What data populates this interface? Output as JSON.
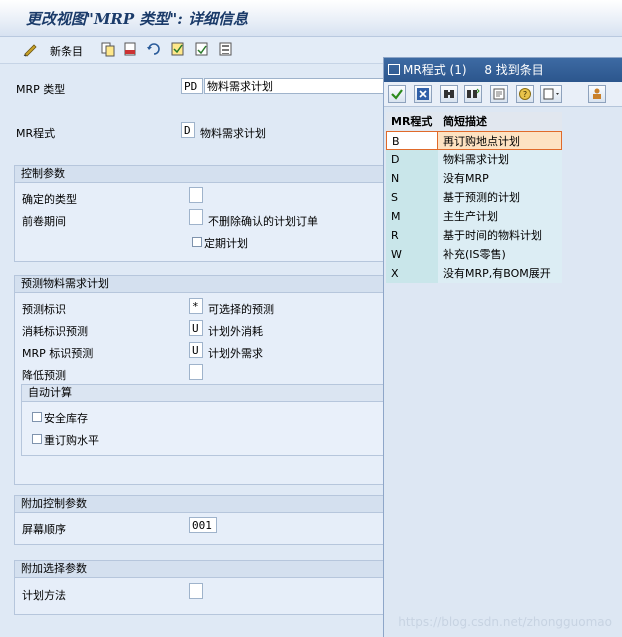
{
  "window_title": "更改视图\"MRP 类型\": 详细信息",
  "toolbar": {
    "new_entries": "新条目"
  },
  "fields": {
    "mrp_type_label": "MRP 类型",
    "mrp_type_code": "PD",
    "mrp_type_desc": "物料需求计划",
    "mrp_proc_label": "MR程式",
    "mrp_proc_code": "D",
    "mrp_proc_desc": "物料需求计划"
  },
  "control": {
    "header": "控制参数",
    "firm_type_label": "确定的类型",
    "rollfwd_label": "前卷期间",
    "rollfwd_text": "不删除确认的计划订单",
    "periodic_label": "定期计划"
  },
  "forecast": {
    "header": "预测物料需求计划",
    "ind_label": "预测标识",
    "ind_value": "*",
    "ind_text": "可选择的预测",
    "cons_label": "消耗标识预测",
    "cons_value": "U",
    "cons_text": "计划外消耗",
    "mrp_label": "MRP 标识预测",
    "mrp_value": "U",
    "mrp_text": "计划外需求",
    "reduce_label": "降低预测",
    "auto_header": "自动计算",
    "safety_label": "安全库存",
    "reorder_label": "重订购水平"
  },
  "additional": {
    "header": "附加控制参数",
    "screen_seq_label": "屏幕顺序",
    "screen_seq_value": "001"
  },
  "selection": {
    "header": "附加选择参数",
    "plan_method_label": "计划方法"
  },
  "popup": {
    "title": "MR程式 (1)",
    "count_text": "8 找到条目",
    "col_code": "MR程式",
    "col_desc": "简短描述",
    "rows": [
      {
        "code": "B",
        "desc": "再订购地点计划"
      },
      {
        "code": "D",
        "desc": "物料需求计划"
      },
      {
        "code": "N",
        "desc": "没有MRP"
      },
      {
        "code": "S",
        "desc": "基于预测的计划"
      },
      {
        "code": "M",
        "desc": "主生产计划"
      },
      {
        "code": "R",
        "desc": "基于时间的物料计划"
      },
      {
        "code": "W",
        "desc": "补充(IS零售)"
      },
      {
        "code": "X",
        "desc": "没有MRP,有BOM展开"
      }
    ]
  },
  "watermark": "https://blog.csdn.net/zhongguomao"
}
